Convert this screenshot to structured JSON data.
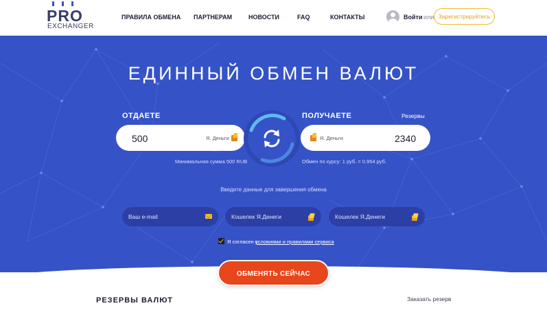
{
  "logo": {
    "main": "PRO",
    "sub": "EXCHANGER"
  },
  "nav": {
    "items": [
      {
        "label": "ПРАВИЛА ОБМЕНА"
      },
      {
        "label": "ПАРТНЕРАМ"
      },
      {
        "label": "НОВОСТИ"
      },
      {
        "label": "FAQ"
      },
      {
        "label": "КОНТАКТЫ"
      }
    ]
  },
  "auth": {
    "login_label": "Войти",
    "or_label": "или",
    "register_label": "Зарегистрируйтесь"
  },
  "hero": {
    "title": "ЕДИННЫЙ ОБМЕН ВАЛЮТ"
  },
  "exchange": {
    "give": {
      "label": "ОТДАЕТЕ",
      "amount": "500",
      "currency": "Я. Деньги",
      "hint": "Минимальная сумма 500 RUB"
    },
    "get": {
      "label": "ПОЛУЧАЕТЕ",
      "amount": "2340",
      "currency": "Я. Деньги",
      "hint": "Обмен по курсу: 1 руб. = 0.954 руб.",
      "reserves_label": "Резервы"
    },
    "swap_icon": "refresh-arrows-icon"
  },
  "form": {
    "prompt": "Введите данные для завершения обмена",
    "email_placeholder": "Ваш e-mail",
    "wallet1_placeholder": "Кошелек Я.Денеги",
    "wallet2_placeholder": "Кошелек Я.Денеги",
    "agree_prefix": "Я согласен с",
    "agree_link": "условиями и правилами сервиса",
    "agree_checked": true
  },
  "submit": {
    "label": "ОБМЕНЯТЬ СЕЙЧАС"
  },
  "reserves": {
    "title": "РЕЗЕРВЫ ВАЛЮТ",
    "order_label": "Заказать резерв"
  },
  "colors": {
    "hero_bg": "#3553c6",
    "accent_orange": "#e8461b",
    "accent_yellow": "#f1b92a",
    "ring_blue": "#5fb9f2"
  }
}
